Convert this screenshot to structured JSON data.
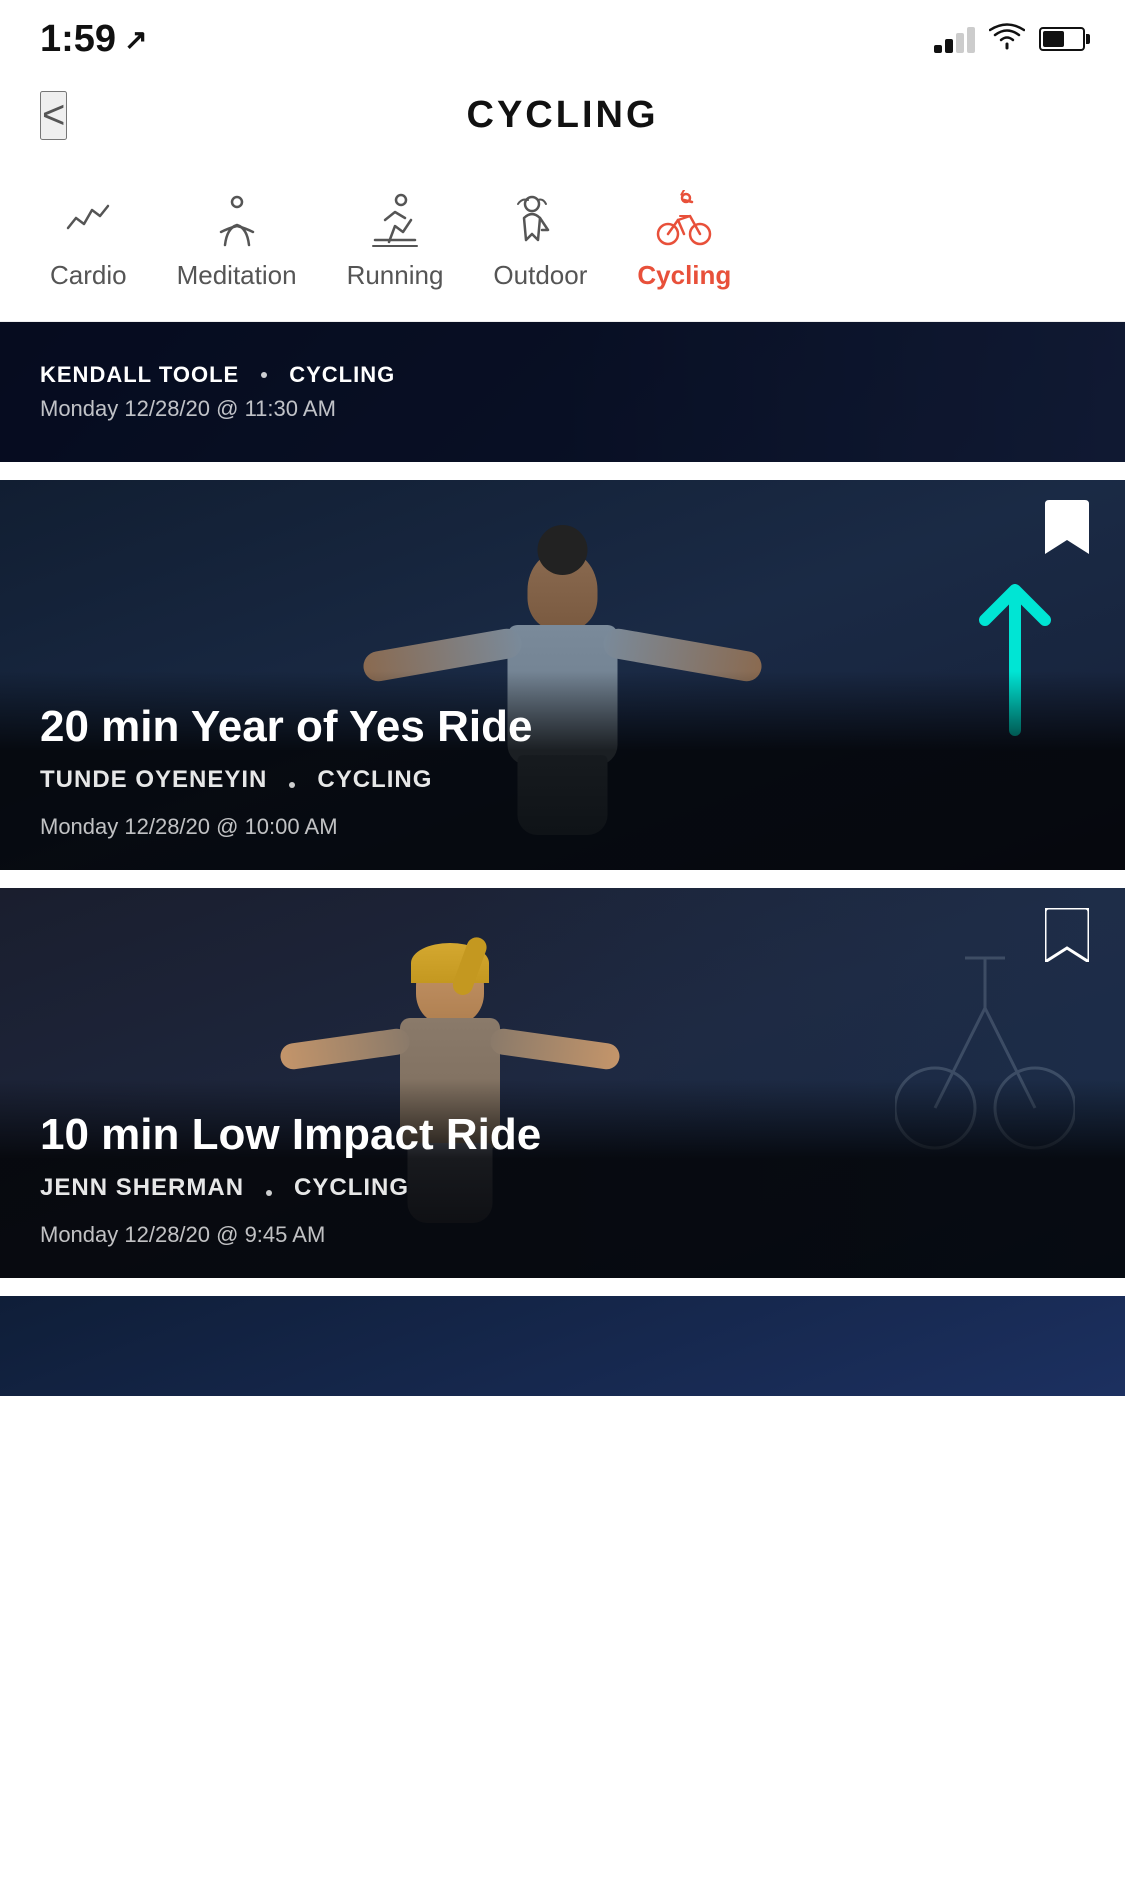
{
  "statusBar": {
    "time": "1:59",
    "locationIcon": "↗"
  },
  "header": {
    "backLabel": "<",
    "title": "CYCLING"
  },
  "categoryNav": {
    "items": [
      {
        "id": "cardio",
        "label": "Cardio",
        "active": false,
        "partial": true
      },
      {
        "id": "meditation",
        "label": "Meditation",
        "active": false
      },
      {
        "id": "running",
        "label": "Running",
        "active": false
      },
      {
        "id": "outdoor",
        "label": "Outdoor",
        "active": false
      },
      {
        "id": "cycling",
        "label": "Cycling",
        "active": true
      }
    ]
  },
  "workoutCards": [
    {
      "id": "card-1",
      "workoutTitle": "",
      "instructor": "KENDALL TOOLE",
      "category": "CYCLING",
      "datetime": "Monday 12/28/20 @ 11:30 AM",
      "bookmarked": false,
      "showArrow": false
    },
    {
      "id": "card-2",
      "workoutTitle": "20 min Year of Yes Ride",
      "instructor": "TUNDE OYENEYIN",
      "category": "CYCLING",
      "datetime": "Monday 12/28/20 @ 10:00 AM",
      "bookmarked": true,
      "showArrow": true
    },
    {
      "id": "card-3",
      "workoutTitle": "10 min Low Impact Ride",
      "instructor": "JENN SHERMAN",
      "category": "CYCLING",
      "datetime": "Monday 12/28/20 @ 9:45 AM",
      "bookmarked": false,
      "showArrow": false
    }
  ],
  "bookmarkIcon": "🔖",
  "separatorDot": "·"
}
